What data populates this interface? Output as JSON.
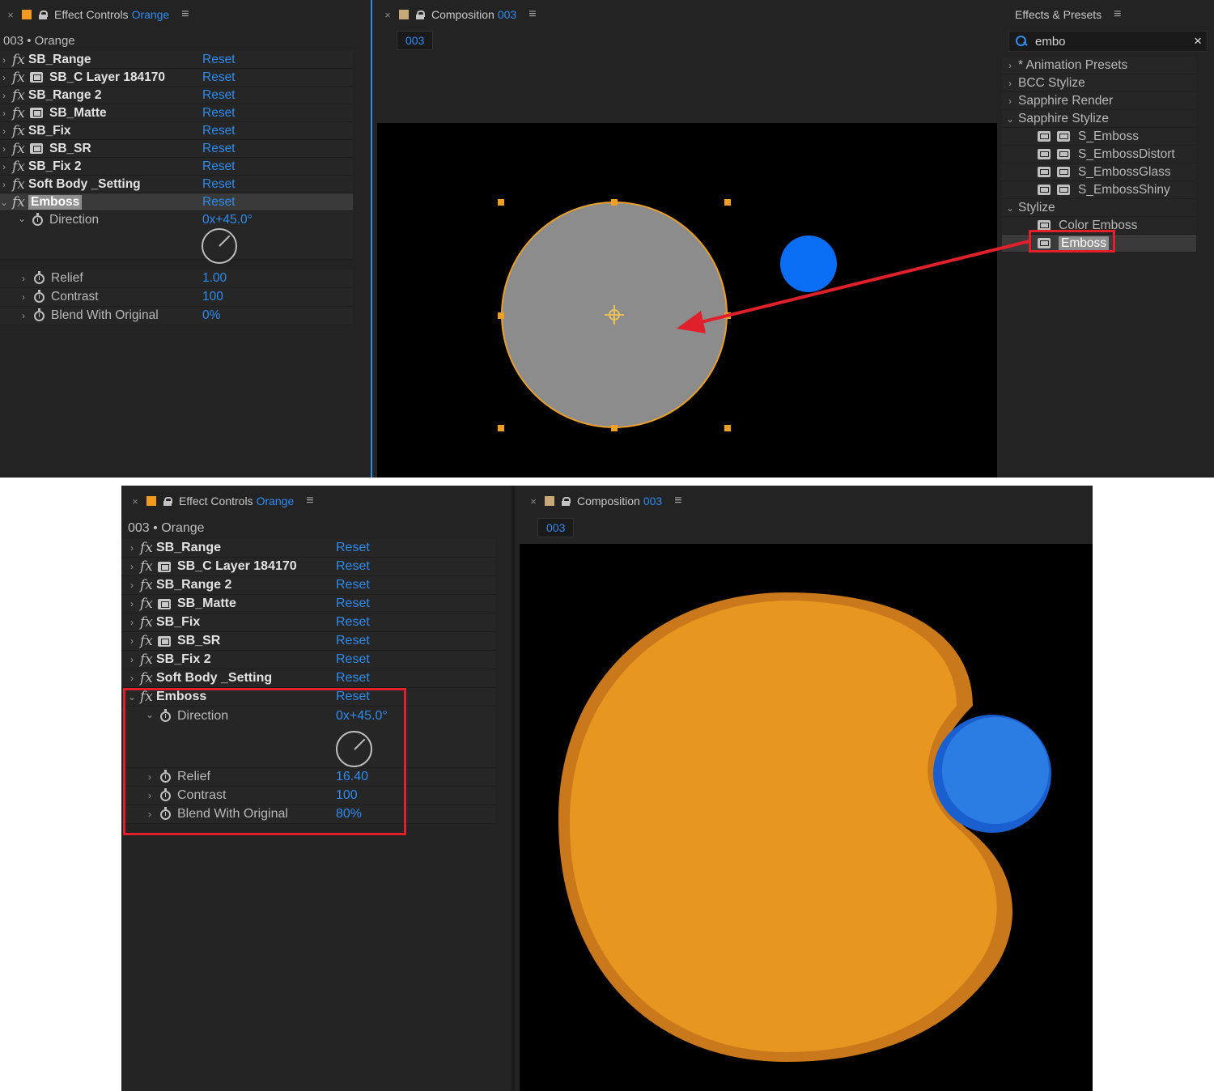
{
  "top": {
    "effect_controls": {
      "tab": {
        "close": "×",
        "title": "Effect Controls",
        "layer": "Orange",
        "menu": "≡",
        "swatch_color": "#f29a1e"
      },
      "header": "003 • Orange",
      "effects": [
        {
          "name": "SB_Range",
          "plugin": false,
          "reset": "Reset"
        },
        {
          "name": "SB_C Layer 184170",
          "plugin": true,
          "reset": "Reset"
        },
        {
          "name": "SB_Range 2",
          "plugin": false,
          "reset": "Reset"
        },
        {
          "name": "SB_Matte",
          "plugin": true,
          "reset": "Reset"
        },
        {
          "name": "SB_Fix",
          "plugin": false,
          "reset": "Reset"
        },
        {
          "name": "SB_SR",
          "plugin": true,
          "reset": "Reset"
        },
        {
          "name": "SB_Fix 2",
          "plugin": false,
          "reset": "Reset"
        },
        {
          "name": "Soft Body _Setting",
          "plugin": false,
          "reset": "Reset"
        }
      ],
      "emboss": {
        "name": "Emboss",
        "reset": "Reset",
        "direction_label": "Direction",
        "direction_value": "0x+45.0°",
        "relief_label": "Relief",
        "relief_value": "1.00",
        "contrast_label": "Contrast",
        "contrast_value": "100",
        "blend_label": "Blend With Original",
        "blend_value": "0%"
      }
    },
    "composition": {
      "tab": {
        "close": "×",
        "title": "Composition",
        "name": "003",
        "menu": "≡",
        "swatch_color": "#c8a878"
      },
      "flag": "003"
    },
    "effects_presets": {
      "tab": {
        "title": "Effects & Presets",
        "menu": "≡"
      },
      "search": {
        "value": "embo",
        "clear": "×"
      },
      "tree": [
        {
          "label": "* Animation Presets",
          "type": "folder",
          "expanded": false
        },
        {
          "label": "BCC Stylize",
          "type": "folder",
          "expanded": false
        },
        {
          "label": "Sapphire Render",
          "type": "folder",
          "expanded": false
        },
        {
          "label": "Sapphire Stylize",
          "type": "folder",
          "expanded": true
        },
        {
          "label": "S_Emboss",
          "type": "preset"
        },
        {
          "label": "S_EmbossDistort",
          "type": "preset"
        },
        {
          "label": "S_EmbossGlass",
          "type": "preset"
        },
        {
          "label": "S_EmbossShiny",
          "type": "preset"
        },
        {
          "label": "Stylize",
          "type": "folder",
          "expanded": true
        },
        {
          "label": "Color Emboss",
          "type": "effect"
        },
        {
          "label": "Emboss",
          "type": "effect",
          "selected": true
        }
      ]
    }
  },
  "bottom": {
    "effect_controls": {
      "tab": {
        "close": "×",
        "title": "Effect Controls",
        "layer": "Orange",
        "menu": "≡",
        "swatch_color": "#f29a1e"
      },
      "header": "003 • Orange",
      "effects": [
        {
          "name": "SB_Range",
          "plugin": false,
          "reset": "Reset"
        },
        {
          "name": "SB_C Layer 184170",
          "plugin": true,
          "reset": "Reset"
        },
        {
          "name": "SB_Range 2",
          "plugin": false,
          "reset": "Reset"
        },
        {
          "name": "SB_Matte",
          "plugin": true,
          "reset": "Reset"
        },
        {
          "name": "SB_Fix",
          "plugin": false,
          "reset": "Reset"
        },
        {
          "name": "SB_SR",
          "plugin": true,
          "reset": "Reset"
        },
        {
          "name": "SB_Fix 2",
          "plugin": false,
          "reset": "Reset"
        },
        {
          "name": "Soft Body _Setting",
          "plugin": false,
          "reset": "Reset"
        }
      ],
      "emboss": {
        "name": "Emboss",
        "reset": "Reset",
        "direction_label": "Direction",
        "direction_value": "0x+45.0°",
        "relief_label": "Relief",
        "relief_value": "16.40",
        "contrast_label": "Contrast",
        "contrast_value": "100",
        "blend_label": "Blend With Original",
        "blend_value": "80%"
      }
    },
    "composition": {
      "tab": {
        "close": "×",
        "title": "Composition",
        "name": "003",
        "menu": "≡",
        "swatch_color": "#c8a878"
      }
    }
  },
  "colors": {
    "accent_blue": "#2e8cf0",
    "callout_red": "#e0202a",
    "orange_layer": "#e7971f",
    "blue_ball": "#0a6ef5",
    "gray_layer": "#8c8c8c"
  }
}
